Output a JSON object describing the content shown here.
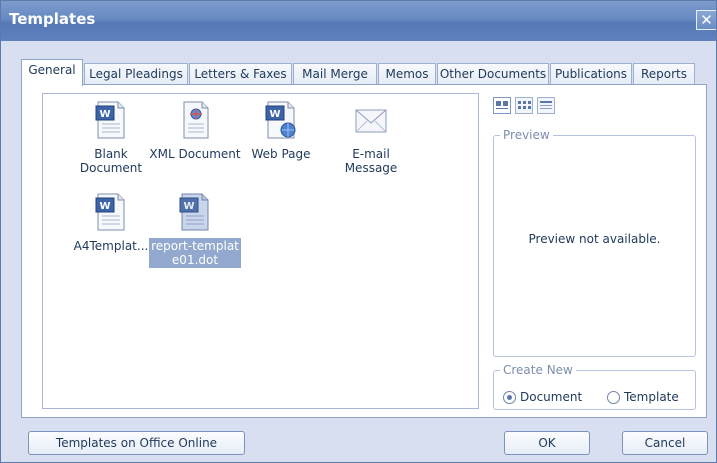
{
  "window": {
    "title": "Templates",
    "close_glyph": "✕"
  },
  "tabs": [
    {
      "label": "General",
      "active": true
    },
    {
      "label": "Legal Pleadings",
      "active": false
    },
    {
      "label": "Letters & Faxes",
      "active": false
    },
    {
      "label": "Mail Merge",
      "active": false
    },
    {
      "label": "Memos",
      "active": false
    },
    {
      "label": "Other Documents",
      "active": false
    },
    {
      "label": "Publications",
      "active": false
    },
    {
      "label": "Reports",
      "active": false
    }
  ],
  "templates": [
    {
      "line1": "Blank",
      "line2": "Document",
      "icon": "word-document-icon",
      "selected": false
    },
    {
      "line1": "XML Document",
      "line2": "",
      "icon": "xml-document-icon",
      "selected": false
    },
    {
      "line1": "Web Page",
      "line2": "",
      "icon": "web-page-icon",
      "selected": false
    },
    {
      "line1": "E-mail",
      "line2": "Message",
      "icon": "email-envelope-icon",
      "selected": false
    },
    {
      "line1": "A4Templat...",
      "line2": "",
      "icon": "word-document-icon",
      "selected": false
    },
    {
      "line1": "report-templat",
      "line2": "e01.dot",
      "icon": "word-template-icon",
      "selected": true
    }
  ],
  "view_buttons": [
    {
      "icon": "large-icons-view-icon",
      "active": true
    },
    {
      "icon": "list-view-icon",
      "active": false
    },
    {
      "icon": "details-view-icon",
      "active": false
    }
  ],
  "preview": {
    "legend": "Preview",
    "message": "Preview not available."
  },
  "create_new": {
    "legend": "Create New",
    "options": [
      {
        "label": "Document",
        "checked": true
      },
      {
        "label": "Template",
        "checked": false
      }
    ]
  },
  "buttons": {
    "online": "Templates on Office Online",
    "ok": "OK",
    "cancel": "Cancel"
  },
  "colors": {
    "titlebar": "#6689c2",
    "selection": "#92a8cf",
    "dialog_bg": "#d7dff0"
  }
}
